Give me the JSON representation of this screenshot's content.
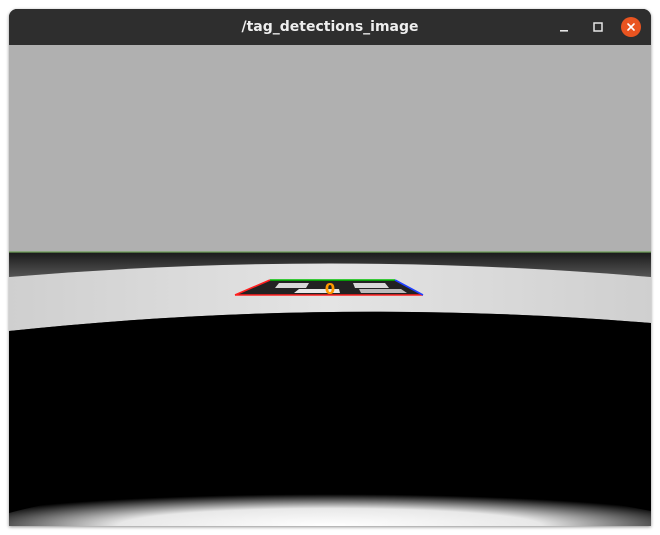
{
  "window": {
    "title": "/tag_detections_image",
    "accent": "#e95420"
  },
  "controls": {
    "minimize_icon": "minimize-icon",
    "maximize_icon": "maximize-icon",
    "close_icon": "close-icon"
  },
  "image": {
    "tag_id": "0",
    "colors": {
      "sky": "#b0b0b0",
      "horizon_line": "#6fa05a",
      "floor_band": "#e2e2e2",
      "dark_region": "#000000",
      "tag_label": "#ff9900",
      "edge_green": "#00c000",
      "edge_blue": "#2040ff",
      "edge_red": "#ff2020"
    }
  }
}
